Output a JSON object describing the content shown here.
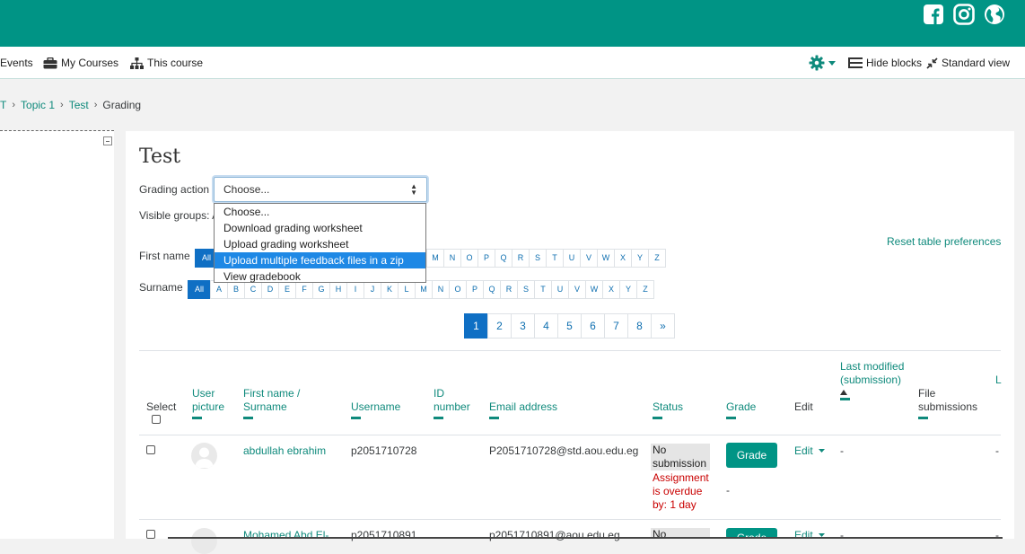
{
  "topbar": {
    "icons": [
      "facebook-icon",
      "instagram-icon",
      "globe-icon"
    ]
  },
  "nav": {
    "events": "Events",
    "my_courses": "My Courses",
    "this_course": "This course",
    "hide_blocks": "Hide blocks",
    "standard_view": "Standard view"
  },
  "breadcrumb": [
    "T",
    "Topic 1",
    "Test",
    "Grading"
  ],
  "page": {
    "title": "Test",
    "grading_action_label": "Grading action",
    "visible_groups_label": "Visible groups: A",
    "first_name_label": "First name",
    "surname_label": "Surname",
    "reset_label": "Reset table preferences"
  },
  "grading_select": {
    "value": "Choose...",
    "options": [
      "Choose...",
      "Download grading worksheet",
      "Upload grading worksheet",
      "Upload multiple feedback files in a zip",
      "View gradebook"
    ],
    "highlighted": "Upload multiple feedback files in a zip"
  },
  "letters": {
    "all": "All",
    "firstname_visible": [
      "M",
      "N",
      "O",
      "P",
      "Q",
      "R",
      "S",
      "T",
      "U",
      "V",
      "W",
      "X",
      "Y",
      "Z"
    ],
    "surname": [
      "A",
      "B",
      "C",
      "D",
      "E",
      "F",
      "G",
      "H",
      "I",
      "J",
      "K",
      "L",
      "M",
      "N",
      "O",
      "P",
      "Q",
      "R",
      "S",
      "T",
      "U",
      "V",
      "W",
      "X",
      "Y",
      "Z"
    ]
  },
  "pagination": [
    "1",
    "2",
    "3",
    "4",
    "5",
    "6",
    "7",
    "8",
    "»"
  ],
  "table": {
    "headers": {
      "select": "Select",
      "user_picture": "User picture",
      "name": "First name / Surname",
      "username": "Username",
      "id_number": "ID number",
      "email": "Email address",
      "status": "Status",
      "grade": "Grade",
      "edit": "Edit",
      "last_modified": "Last modified (submission)",
      "file_submissions": "File submissions",
      "last_col": "L"
    },
    "rows": [
      {
        "name": "abdullah ebrahim",
        "username": "p2051710728",
        "email": "P2051710728@std.aou.edu.eg",
        "status": "No submission",
        "overdue": "Assignment is overdue by: 1 day",
        "grade_button": "Grade",
        "grade_value": "-",
        "edit": "Edit",
        "last_modified": "-",
        "extra": "-"
      },
      {
        "name": "Mohamed Abd El-",
        "username": "p2051710891",
        "email": "p2051710891@aou.edu.eg",
        "status": "No",
        "grade_button": "Grade",
        "edit": "Edit",
        "last_modified": "-",
        "extra": "-"
      }
    ]
  }
}
